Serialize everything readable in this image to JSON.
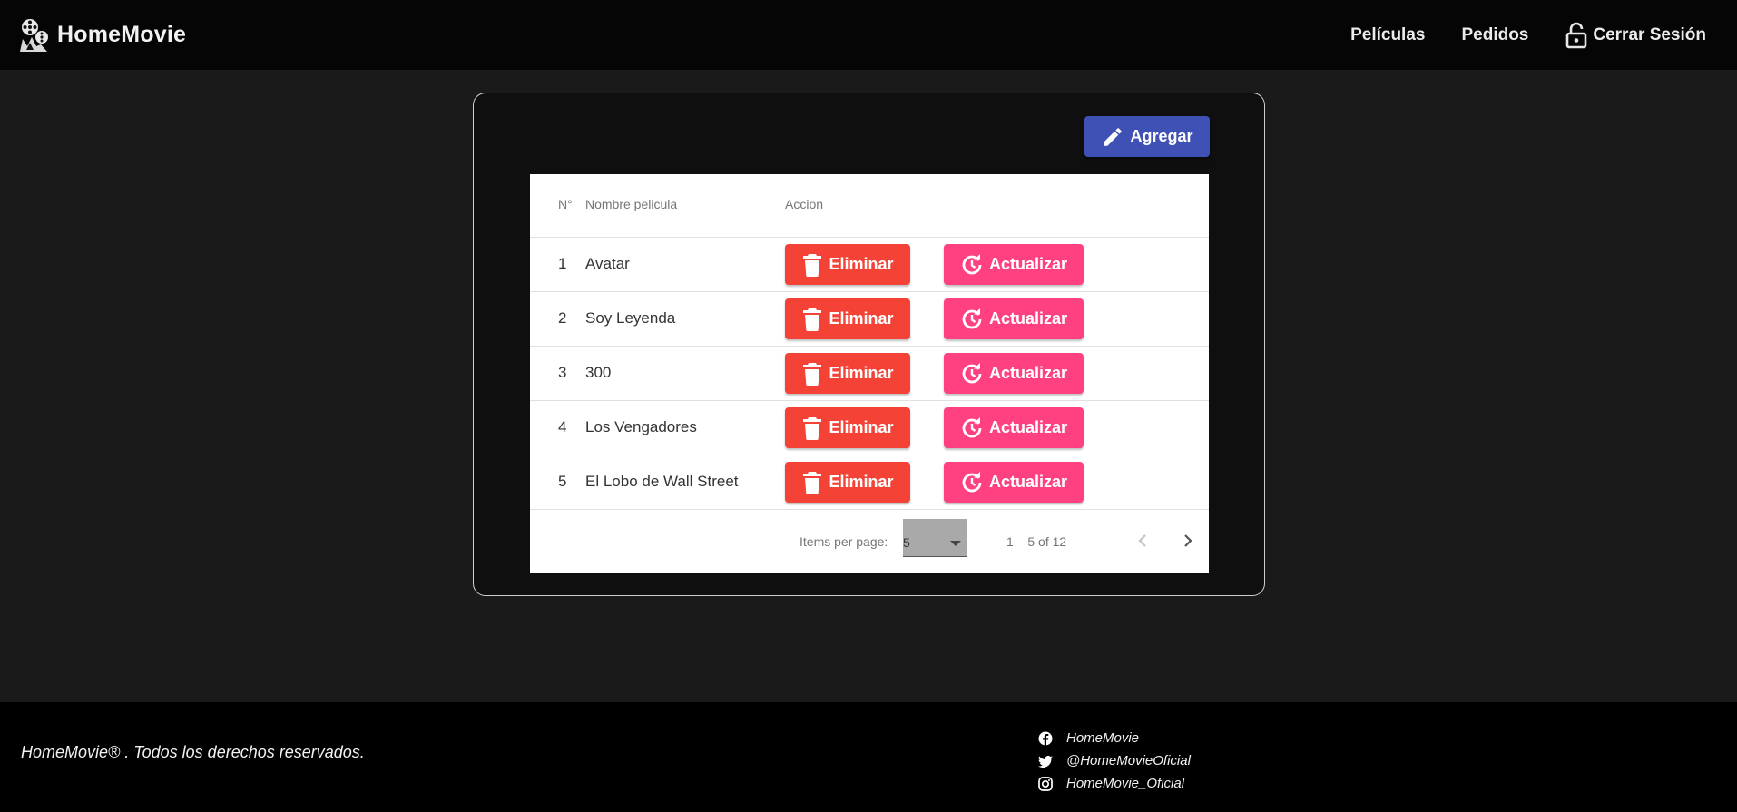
{
  "header": {
    "brand": "HomeMovie",
    "nav": {
      "peliculas": "Películas",
      "pedidos": "Pedidos",
      "logout": "Cerrar Sesión"
    }
  },
  "toolbar": {
    "add_label": "Agregar"
  },
  "table": {
    "headers": {
      "number": "N°",
      "name": "Nombre pelicula",
      "action": "Accion"
    },
    "delete_label": "Eliminar",
    "update_label": "Actualizar",
    "rows": [
      {
        "number": "1",
        "name": "Avatar"
      },
      {
        "number": "2",
        "name": "Soy Leyenda"
      },
      {
        "number": "3",
        "name": "300"
      },
      {
        "number": "4",
        "name": "Los Vengadores"
      },
      {
        "number": "5",
        "name": "El Lobo de Wall Street"
      }
    ]
  },
  "paginator": {
    "label": "Items per page:",
    "page_size": "5",
    "range": "1 – 5 of 12"
  },
  "footer": {
    "copyright": "HomeMovie® . Todos los derechos reservados.",
    "social": {
      "facebook": "HomeMovie",
      "twitter": "@HomeMovieOficial",
      "instagram": "HomeMovie_Oficial"
    }
  },
  "colors": {
    "header_bg": "#050505",
    "page_bg": "#1a1a1a",
    "primary": "#3f51b5",
    "warn": "#f44336",
    "accent": "#ff4081"
  },
  "icons": [
    "film-reel-logo-icon",
    "lock-open-icon",
    "pencil-icon",
    "trash-icon",
    "refresh-icon",
    "chevron-left-icon",
    "chevron-right-icon",
    "facebook-icon",
    "twitter-icon",
    "instagram-icon"
  ]
}
